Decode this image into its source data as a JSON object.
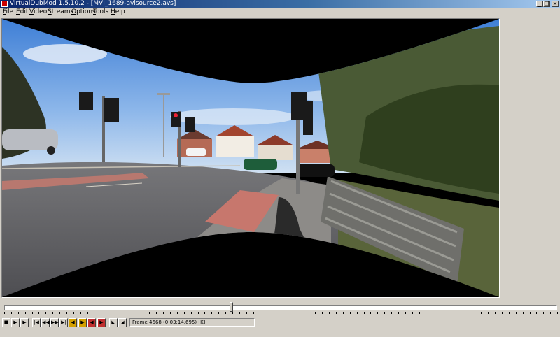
{
  "window": {
    "title": "VirtualDubMod 1.5.10.2 - [MVI_1689-avisource2.avs]",
    "controls": {
      "minimize": "_",
      "restore": "❐",
      "close": "✕"
    }
  },
  "menu": [
    {
      "label": "File",
      "key": "F"
    },
    {
      "label": "Edit",
      "key": "E"
    },
    {
      "label": "Video",
      "key": "V"
    },
    {
      "label": "Streams",
      "key": "S"
    },
    {
      "label": "Options",
      "key": "O"
    },
    {
      "label": "Tools",
      "key": "T"
    },
    {
      "label": "Help",
      "key": "H"
    }
  ],
  "position": {
    "fraction": 0.41
  },
  "toolbar": {
    "buttons": [
      {
        "name": "stop-button",
        "glyph": "■"
      },
      {
        "name": "play-input-button",
        "glyph": "▶"
      },
      {
        "name": "play-output-button",
        "glyph": "▶"
      },
      {
        "name": "go-start-button",
        "glyph": "|◀"
      },
      {
        "name": "step-back-button",
        "glyph": "◀◀"
      },
      {
        "name": "step-forward-button",
        "glyph": "▶▶"
      },
      {
        "name": "go-end-button",
        "glyph": "▶|"
      },
      {
        "name": "prev-keyframe-button",
        "glyph": "◀"
      },
      {
        "name": "next-keyframe-button",
        "glyph": "▶"
      },
      {
        "name": "scene-back-button",
        "glyph": "◀"
      },
      {
        "name": "scene-forward-button",
        "glyph": "▶"
      },
      {
        "name": "mark-in-button",
        "glyph": "◣"
      },
      {
        "name": "mark-out-button",
        "glyph": "◢"
      }
    ],
    "accent_colors": {
      "keyframe": "#d4a000",
      "scene": "#c03030"
    }
  },
  "status": {
    "frame_text": "Frame 4668 (0:03:14.695) [K]"
  }
}
